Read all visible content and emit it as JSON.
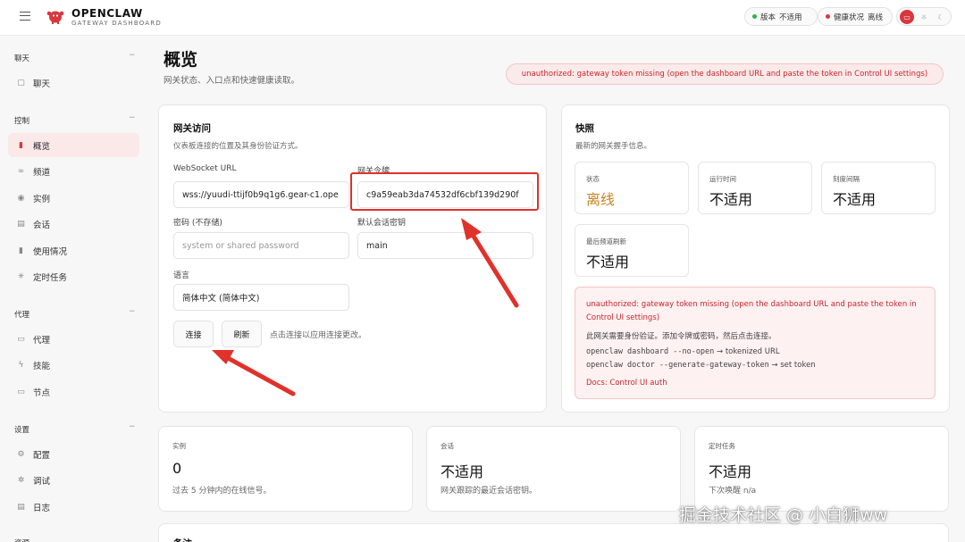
{
  "brand": {
    "name": "OPENCLAW",
    "subtitle": "GATEWAY DASHBOARD"
  },
  "topbar": {
    "version_label": "版本",
    "version_value": "不适用",
    "health_label": "健康状况",
    "health_value": "离线",
    "version_dot_color": "#2fb344",
    "health_dot_color": "#d9363e"
  },
  "sidebar": {
    "groups": [
      {
        "label": "聊天",
        "items": [
          "聊天"
        ]
      },
      {
        "label": "控制",
        "items": [
          "概览",
          "频道",
          "实例",
          "会话",
          "使用情况",
          "定时任务"
        ]
      },
      {
        "label": "代理",
        "items": [
          "代理",
          "技能",
          "节点"
        ]
      },
      {
        "label": "设置",
        "items": [
          "配置",
          "调试",
          "日志"
        ]
      },
      {
        "label": "资源"
      }
    ],
    "active_item": "概览"
  },
  "page": {
    "title": "概览",
    "subtitle": "网关状态、入口点和快速健康读取。",
    "error_banner": "unauthorized: gateway token missing (open the dashboard URL and paste the token in Control UI settings)"
  },
  "gateway_access": {
    "title": "网关访问",
    "subtitle": "仪表板连接的位置及其身份验证方式。",
    "ws_label": "WebSocket URL",
    "ws_value": "wss://yuudi-ttijf0b9q1g6.gear-c1.ope",
    "token_label": "网关令牌",
    "token_value": "c9a59eab3da74532df6cbf139d290f",
    "password_label": "密码 (不存储)",
    "password_placeholder": "system or shared password",
    "session_label": "默认会话密钥",
    "session_value": "main",
    "language_label": "语言",
    "language_value": "简体中文 (简体中文)",
    "connect_button": "连接",
    "refresh_button": "刷新",
    "hint": "点击连接以应用连接更改。"
  },
  "snapshot": {
    "title": "快照",
    "subtitle": "最新的网关握手信息。",
    "stats": [
      {
        "label": "状态",
        "value": "离线"
      },
      {
        "label": "运行时间",
        "value": "不适用"
      },
      {
        "label": "刻度间隔",
        "value": "不适用"
      },
      {
        "label": "最后频道刷新",
        "value": "不适用"
      }
    ],
    "alert": {
      "title": "unauthorized: gateway token missing (open the dashboard URL and paste the token in Control UI settings)",
      "text": "此网关需要身份验证。添加令牌或密码，然后点击连接。",
      "cmd1": "openclaw dashboard --no-open",
      "cmd1_result": "→ tokenized URL",
      "cmd2": "openclaw doctor --generate-gateway-token",
      "cmd2_result": "→ set token",
      "link": "Docs: Control UI auth"
    }
  },
  "summary_cards": [
    {
      "label": "实例",
      "value": "0",
      "sub": "过去 5 分钟内的在线信号。"
    },
    {
      "label": "会话",
      "value": "不适用",
      "sub": "网关跟踪的最近会话密钥。"
    },
    {
      "label": "定时任务",
      "value": "不适用",
      "sub": "下次唤醒 n/a"
    }
  ],
  "notes_title": "备注",
  "watermark": "掘金技术社区 @ 小白狮ww",
  "colors": {
    "accent": "#d9363e",
    "annotation": "#e0312b",
    "offline": "#c98320"
  }
}
